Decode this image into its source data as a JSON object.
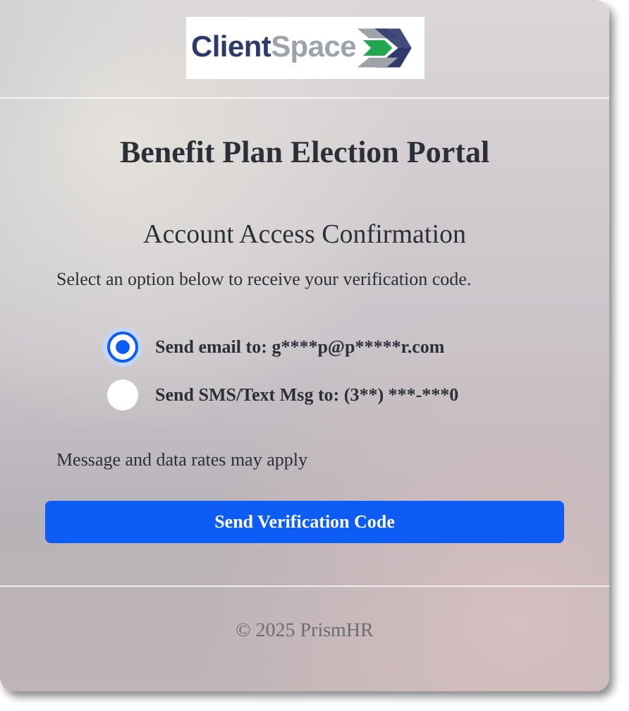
{
  "logo": {
    "parts": [
      "Client",
      "Space"
    ]
  },
  "title": "Benefit Plan Election Portal",
  "subtitle": "Account Access Confirmation",
  "instruction": "Select an option below to receive your verification code.",
  "options": [
    {
      "label": "Send email to: g****p@p*****r.com",
      "selected": true
    },
    {
      "label": "Send SMS/Text Msg to: (3**) ***-***0",
      "selected": false
    }
  ],
  "note": "Message and data rates may apply",
  "button": "Send Verification Code",
  "footer": "© 2025 PrismHR"
}
